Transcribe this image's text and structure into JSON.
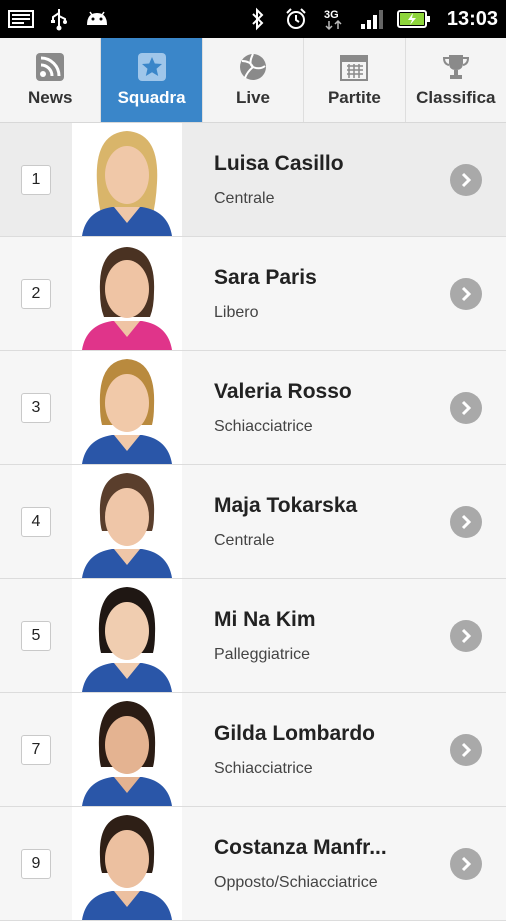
{
  "status_bar": {
    "time": "13:03",
    "network": "3G",
    "icons": [
      "screenshot-icon",
      "usb-icon",
      "android-icon",
      "bluetooth-icon",
      "alarm-icon",
      "signal-icon",
      "battery-charging-icon"
    ]
  },
  "tabs": [
    {
      "label": "News",
      "icon": "rss-icon",
      "active": false
    },
    {
      "label": "Squadra",
      "icon": "team-star-icon",
      "active": true
    },
    {
      "label": "Live",
      "icon": "volleyball-icon",
      "active": false
    },
    {
      "label": "Partite",
      "icon": "calendar-icon",
      "active": false
    },
    {
      "label": "Classifica",
      "icon": "trophy-icon",
      "active": false
    }
  ],
  "players": [
    {
      "number": "1",
      "name": "Luisa Casillo",
      "role": "Centrale",
      "hair": "#d9b56a",
      "jersey": "#2a56a8"
    },
    {
      "number": "2",
      "name": "Sara Paris",
      "role": "Libero",
      "hair": "#4a3222",
      "jersey": "#e0348a"
    },
    {
      "number": "3",
      "name": "Valeria Rosso",
      "role": "Schiacciatrice",
      "hair": "#b98a3e",
      "jersey": "#2a56a8"
    },
    {
      "number": "4",
      "name": "Maja Tokarska",
      "role": "Centrale",
      "hair": "#5a3e2c",
      "jersey": "#2a56a8"
    },
    {
      "number": "5",
      "name": "Mi Na Kim",
      "role": "Palleggiatrice",
      "hair": "#1f1713",
      "jersey": "#2a56a8"
    },
    {
      "number": "7",
      "name": "Gilda Lombardo",
      "role": "Schiacciatrice",
      "hair": "#2b1c14",
      "jersey": "#2a56a8"
    },
    {
      "number": "9",
      "name": "Costanza Manfr...",
      "role": "Opposto/Schiacciatrice",
      "hair": "#2e1f16",
      "jersey": "#2a56a8"
    }
  ],
  "colors": {
    "accent": "#3a86c9",
    "arrow": "#a9a9a9"
  }
}
